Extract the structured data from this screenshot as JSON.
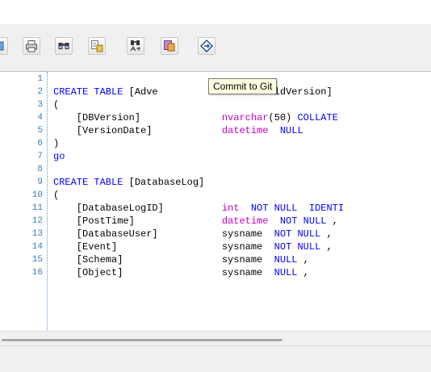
{
  "tooltip": {
    "text": "Commit to Git"
  },
  "toolbar": {
    "buttons": [
      {
        "icon": "partial-left-icon"
      },
      {
        "icon": "print-icon"
      },
      {
        "icon": "find-icon"
      },
      {
        "icon": "find-replace-icon"
      },
      {
        "icon": "find-next-icon"
      },
      {
        "icon": "compare-icon"
      },
      {
        "icon": "commit-to-git-icon"
      }
    ]
  },
  "editor": {
    "colors": {
      "keyword": "#0000ff",
      "type": "#c000c0",
      "line_number": "#3a7cbf"
    },
    "lines": [
      {
        "num": "1",
        "tokens": []
      },
      {
        "num": "2",
        "tokens": [
          {
            "t": "CREATE TABLE",
            "c": "kw"
          },
          {
            "t": " [Adve",
            "c": "text"
          },
          {
            "t": "                ",
            "c": "text"
          },
          {
            "t": "WBuildVersion]",
            "c": "text"
          }
        ]
      },
      {
        "num": "3",
        "tokens": [
          {
            "t": "(",
            "c": "text"
          }
        ]
      },
      {
        "num": "4",
        "tokens": [
          {
            "t": "    [DBVersion]              ",
            "c": "text"
          },
          {
            "t": "nvarchar",
            "c": "type"
          },
          {
            "t": "(50) ",
            "c": "text"
          },
          {
            "t": "COLLATE",
            "c": "kw"
          }
        ]
      },
      {
        "num": "5",
        "tokens": [
          {
            "t": "    [VersionDate]            ",
            "c": "text"
          },
          {
            "t": "datetime",
            "c": "type"
          },
          {
            "t": "  ",
            "c": "text"
          },
          {
            "t": "NULL",
            "c": "kw"
          }
        ]
      },
      {
        "num": "6",
        "tokens": [
          {
            "t": ")",
            "c": "text"
          }
        ]
      },
      {
        "num": "7",
        "tokens": [
          {
            "t": "go",
            "c": "kw"
          }
        ]
      },
      {
        "num": "8",
        "tokens": []
      },
      {
        "num": "9",
        "tokens": [
          {
            "t": "CREATE TABLE",
            "c": "kw"
          },
          {
            "t": " [DatabaseLog]",
            "c": "text"
          }
        ]
      },
      {
        "num": "10",
        "tokens": [
          {
            "t": "(",
            "c": "text"
          }
        ]
      },
      {
        "num": "11",
        "tokens": [
          {
            "t": "    [DatabaseLogID]          ",
            "c": "text"
          },
          {
            "t": "int",
            "c": "type"
          },
          {
            "t": "  ",
            "c": "text"
          },
          {
            "t": "NOT NULL",
            "c": "kw"
          },
          {
            "t": "  ",
            "c": "text"
          },
          {
            "t": "IDENTI",
            "c": "kw"
          }
        ]
      },
      {
        "num": "12",
        "tokens": [
          {
            "t": "    [PostTime]               ",
            "c": "text"
          },
          {
            "t": "datetime",
            "c": "type"
          },
          {
            "t": "  ",
            "c": "text"
          },
          {
            "t": "NOT NULL",
            "c": "kw"
          },
          {
            "t": " ,",
            "c": "text"
          }
        ]
      },
      {
        "num": "13",
        "tokens": [
          {
            "t": "    [DatabaseUser]           ",
            "c": "text"
          },
          {
            "t": "sysname",
            "c": "text"
          },
          {
            "t": "  ",
            "c": "text"
          },
          {
            "t": "NOT NULL",
            "c": "kw"
          },
          {
            "t": " ,",
            "c": "text"
          }
        ]
      },
      {
        "num": "14",
        "tokens": [
          {
            "t": "    [Event]                  ",
            "c": "text"
          },
          {
            "t": "sysname",
            "c": "text"
          },
          {
            "t": "  ",
            "c": "text"
          },
          {
            "t": "NOT NULL",
            "c": "kw"
          },
          {
            "t": " ,",
            "c": "text"
          }
        ]
      },
      {
        "num": "15",
        "tokens": [
          {
            "t": "    [Schema]                 ",
            "c": "text"
          },
          {
            "t": "sysname",
            "c": "text"
          },
          {
            "t": "  ",
            "c": "text"
          },
          {
            "t": "NULL",
            "c": "kw"
          },
          {
            "t": " ,",
            "c": "text"
          }
        ]
      },
      {
        "num": "16",
        "tokens": [
          {
            "t": "    [Object]                 ",
            "c": "text"
          },
          {
            "t": "sysname",
            "c": "text"
          },
          {
            "t": "  ",
            "c": "text"
          },
          {
            "t": "NULL",
            "c": "kw"
          },
          {
            "t": " ,",
            "c": "text"
          }
        ]
      }
    ]
  }
}
